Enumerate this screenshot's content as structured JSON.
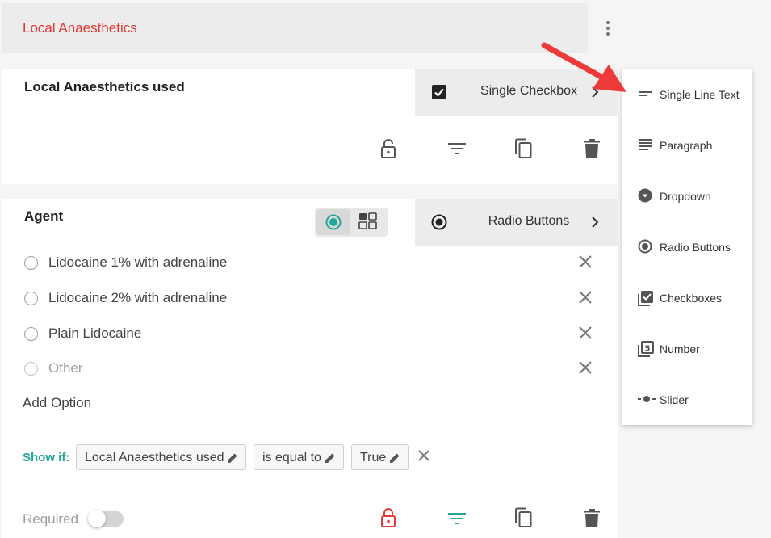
{
  "section": {
    "title": "Local Anaesthetics"
  },
  "question1": {
    "title": "Local Anaesthetics used",
    "type_label": "Single Checkbox"
  },
  "question2": {
    "title": "Agent",
    "type_label": "Radio Buttons",
    "options": [
      {
        "label": "Lidocaine 1% with adrenaline"
      },
      {
        "label": "Lidocaine 2% with adrenaline"
      },
      {
        "label": "Plain Lidocaine"
      },
      {
        "label": "Other"
      }
    ],
    "add_option_label": "Add Option",
    "show_if": {
      "label": "Show if:",
      "field": "Local Anaesthetics used",
      "operator": "is equal to",
      "value": "True"
    },
    "required_label": "Required",
    "required": false
  },
  "type_menu": {
    "items": [
      {
        "label": "Single Line Text",
        "icon": "short-text-icon"
      },
      {
        "label": "Paragraph",
        "icon": "paragraph-icon"
      },
      {
        "label": "Dropdown",
        "icon": "dropdown-icon"
      },
      {
        "label": "Radio Buttons",
        "icon": "radio-button-icon"
      },
      {
        "label": "Checkboxes",
        "icon": "checkboxes-icon"
      },
      {
        "label": "Number",
        "icon": "number-icon"
      },
      {
        "label": "Slider",
        "icon": "slider-icon"
      }
    ]
  },
  "colors": {
    "section_title": "#e53935",
    "accent_teal": "#26a69a",
    "lock_red": "#e53935",
    "arrow_red": "#ee3a3a"
  }
}
